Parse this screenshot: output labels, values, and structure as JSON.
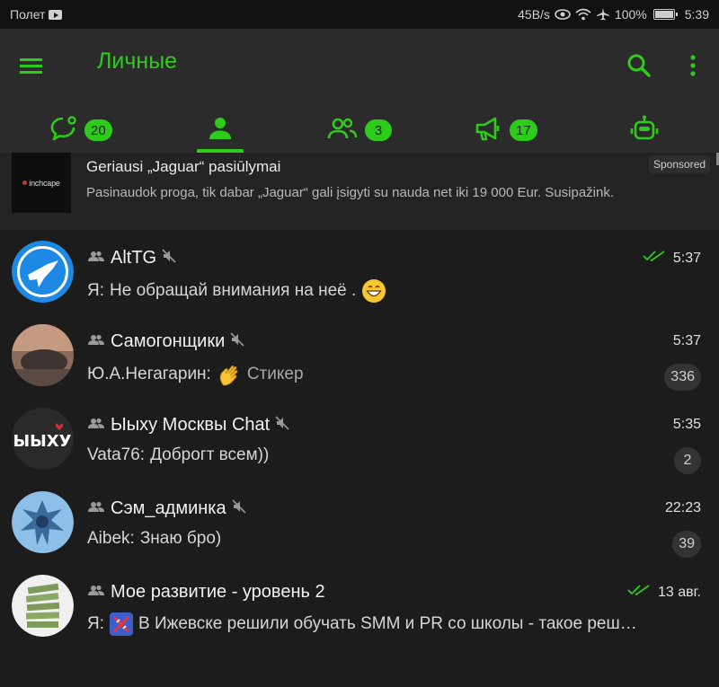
{
  "status_bar": {
    "carrier": "Полет",
    "net_speed": "45B/s",
    "battery": "100%",
    "time": "5:39"
  },
  "header": {
    "title": "Личные",
    "icons": [
      "menu-icon",
      "search-icon",
      "more-vert-icon"
    ]
  },
  "tabs": [
    {
      "icon": "chat-bubble-icon",
      "badge": "20"
    },
    {
      "icon": "person-icon",
      "badge": "",
      "active": true
    },
    {
      "icon": "group-icon",
      "badge": "3"
    },
    {
      "icon": "megaphone-icon",
      "badge": "17"
    },
    {
      "icon": "bot-icon",
      "badge": ""
    }
  ],
  "sponsored": {
    "logo_text": "inchcape",
    "title": "Geriausi „Jaguar“ pasiūlymai",
    "text": "Pasinaudok proga, tik dabar „Jaguar“ gali įsigyti su nauda net iki 19 000 Eur. Susipažink.",
    "badge": "Sponsored"
  },
  "chats": [
    {
      "name": "AltTG",
      "muted": true,
      "time": "5:37",
      "read": true,
      "sender": "Я:",
      "message": "Не обращай внимания на неё .",
      "emoji": "grin",
      "count": ""
    },
    {
      "name": "Самогонщики",
      "muted": true,
      "time": "5:37",
      "read": false,
      "sender": "Ю.А.Негагарин:",
      "message": "Стикер",
      "emoji": "wave",
      "count": "336"
    },
    {
      "name": "Ыыху Москвы Chat",
      "muted": true,
      "time": "5:35",
      "read": false,
      "sender": "Vata76:",
      "message": "Доброгт всем))",
      "emoji": "",
      "count": "2"
    },
    {
      "name": "Сэм_админка",
      "muted": true,
      "time": "22:23",
      "read": false,
      "sender": "Aibek:",
      "message": "Знаю бро)",
      "emoji": "",
      "count": "39"
    },
    {
      "name": "Мое развитие - уровень 2",
      "muted": false,
      "time": "13 авг.",
      "read": true,
      "sender": "Я:",
      "message": "В Ижевске решили обучать SMM и PR со школы - такое реш…",
      "emoji": "dna",
      "count": ""
    }
  ],
  "avatars": [
    {
      "label": "",
      "colors": [
        "#1e88e5",
        "#ffffff"
      ]
    },
    {
      "label": "",
      "colors": [
        "#5d4e47",
        "#c8a27a"
      ]
    },
    {
      "label": "ЫЫХУ",
      "colors": [
        "#2a2a2a",
        "#ffffff"
      ]
    },
    {
      "label": "",
      "colors": [
        "#3b6a9a",
        "#8cc0e8"
      ]
    },
    {
      "label": "",
      "colors": [
        "#f0f0f0",
        "#7d9a5a"
      ]
    }
  ],
  "colors": {
    "accent": "#2ecc1a",
    "background": "#1c1c1c",
    "header": "#2b2b2b",
    "sponsored_bg": "#232323"
  }
}
